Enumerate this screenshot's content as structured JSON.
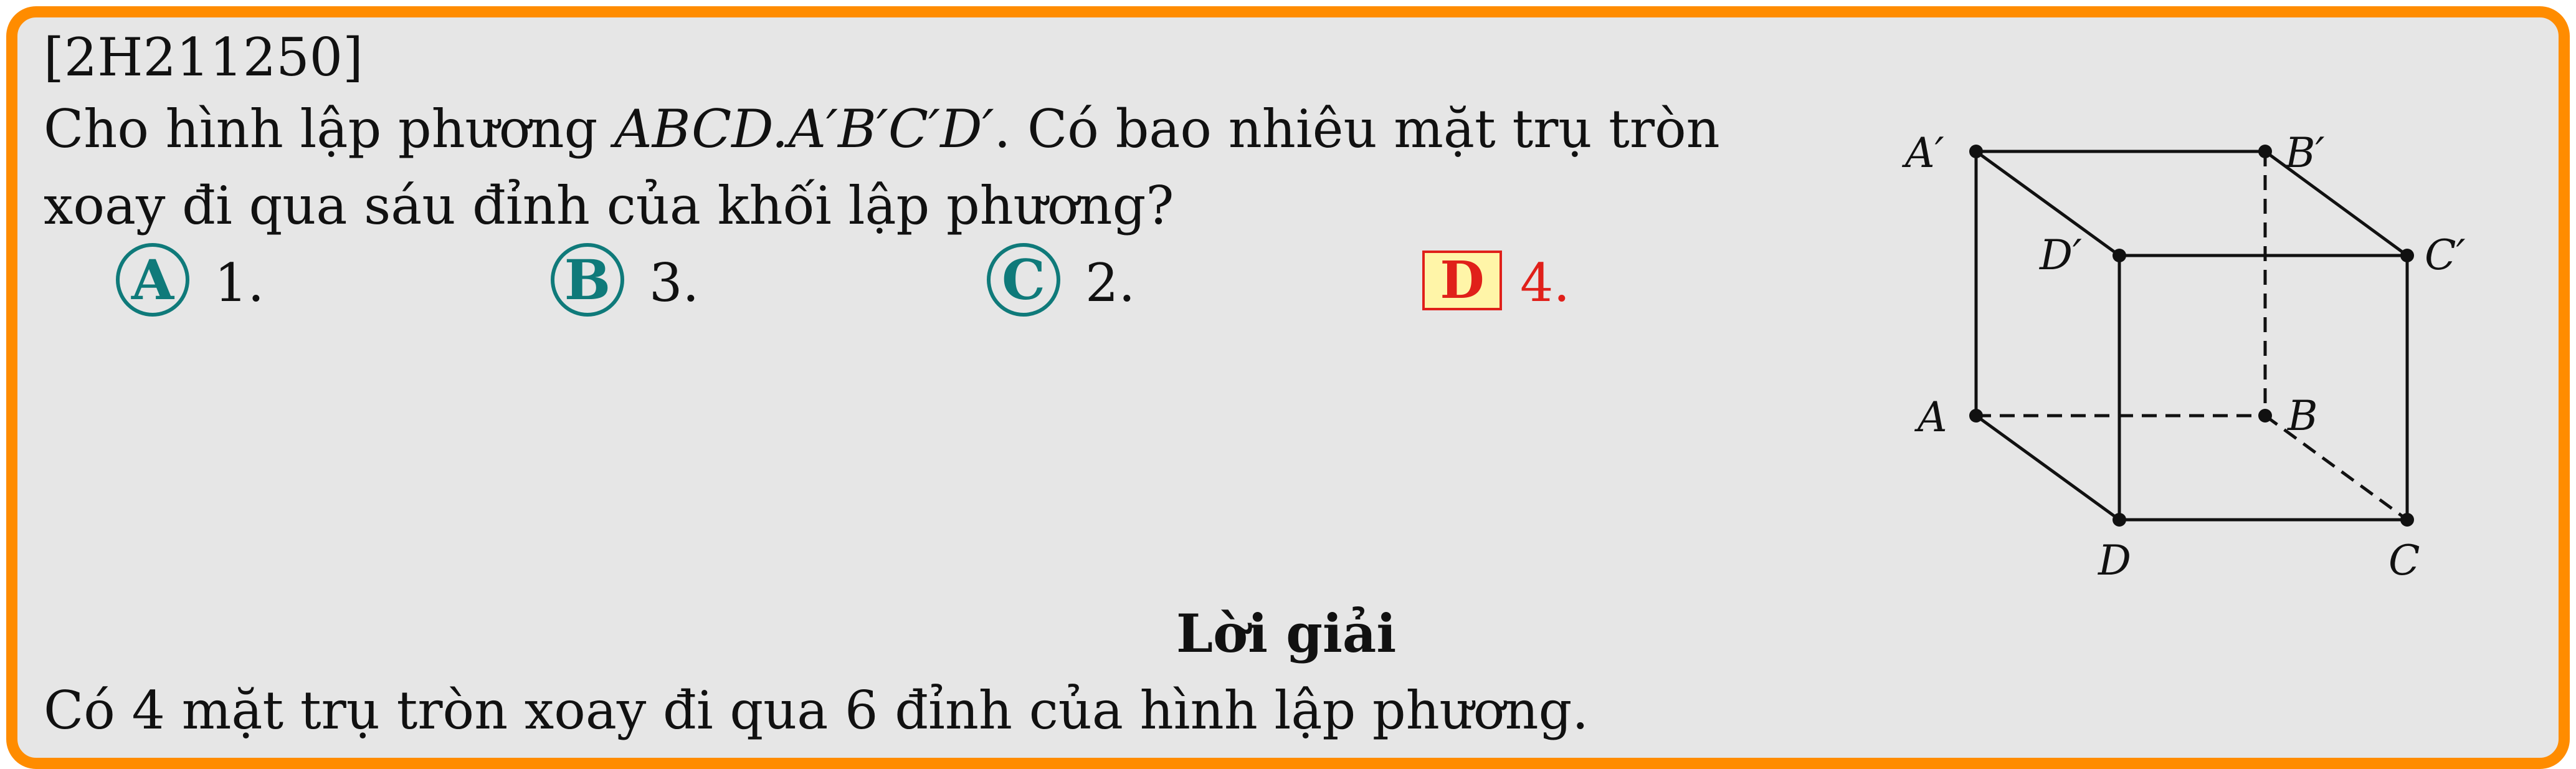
{
  "problem": {
    "code": "[2H211250]",
    "question_line1_a": "Cho hình lập phương ",
    "question_math": "ABCD.A′B′C′D′",
    "question_line1_b": ". Có bao nhiêu mặt trụ tròn",
    "question_line2": "xoay đi qua sáu đỉnh của khối lập phương?"
  },
  "options": [
    {
      "letter": "A",
      "value": "1.",
      "correct": false
    },
    {
      "letter": "B",
      "value": "3.",
      "correct": false
    },
    {
      "letter": "C",
      "value": "2.",
      "correct": false
    },
    {
      "letter": "D",
      "value": "4.",
      "correct": true
    }
  ],
  "figure": {
    "labels": [
      "A′",
      "B′",
      "C′",
      "D′",
      "A",
      "B",
      "C",
      "D"
    ]
  },
  "solution": {
    "heading": "Lời giải",
    "text": "Có 4 mặt trụ tròn xoay đi qua 6 đỉnh của hình lập phương."
  },
  "colors": {
    "border": "#ff8c00",
    "background": "#e6e6e6",
    "option_circle": "#0f7a7a",
    "answer_highlight": "#e0201a",
    "answer_fill": "#fff5a8"
  }
}
